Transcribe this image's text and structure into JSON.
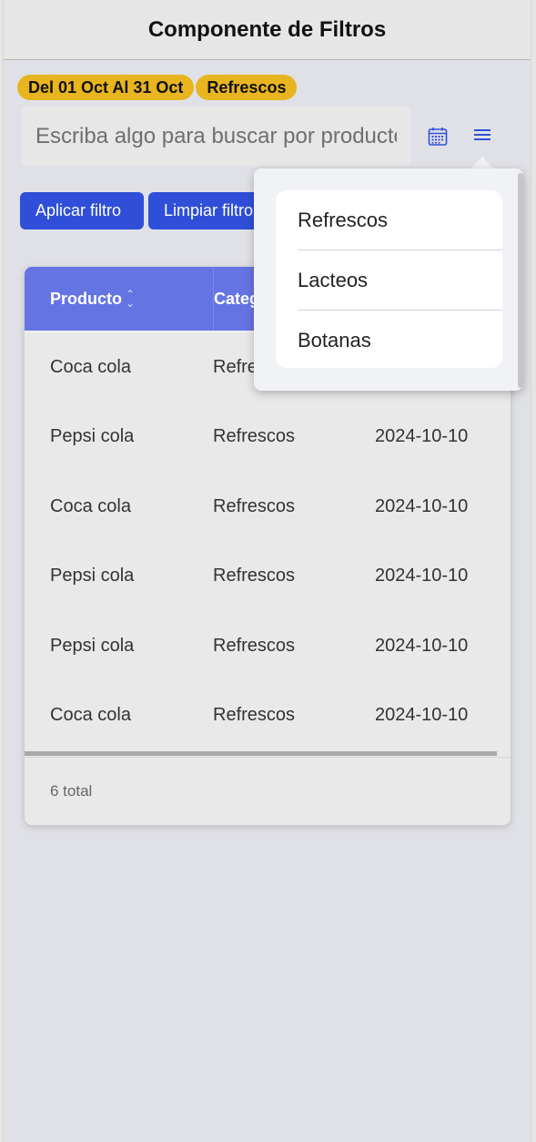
{
  "header": {
    "title": "Componente de Filtros"
  },
  "chips": [
    {
      "label": "Del 01 Oct Al 31 Oct"
    },
    {
      "label": "Refrescos"
    }
  ],
  "search": {
    "placeholder": "Escriba algo para buscar por producto",
    "value": ""
  },
  "icons": {
    "calendar": "calendar-icon",
    "menu": "hamburger-menu-icon",
    "sort": "sort-icon"
  },
  "buttons": {
    "apply": "Aplicar filtro",
    "clear": "Limpiar filtro"
  },
  "table": {
    "columns": [
      "Producto",
      "Categ"
    ],
    "rows": [
      {
        "producto": "Coca cola",
        "categoria": "Refre",
        "fecha": ""
      },
      {
        "producto": "Pepsi cola",
        "categoria": "Refrescos",
        "fecha": "2024-10-10"
      },
      {
        "producto": "Coca cola",
        "categoria": "Refrescos",
        "fecha": "2024-10-10"
      },
      {
        "producto": "Pepsi cola",
        "categoria": "Refrescos",
        "fecha": "2024-10-10"
      },
      {
        "producto": "Pepsi cola",
        "categoria": "Refrescos",
        "fecha": "2024-10-10"
      },
      {
        "producto": "Coca cola",
        "categoria": "Refrescos",
        "fecha": "2024-10-10"
      }
    ],
    "total": "6 total"
  },
  "dropdown": {
    "items": [
      "Refrescos",
      "Lacteos",
      "Botanas"
    ]
  },
  "colors": {
    "accent": "#2f4fd8",
    "chip": "#e8b520",
    "table_header": "#6574e3",
    "background": "#e0e1e6"
  }
}
